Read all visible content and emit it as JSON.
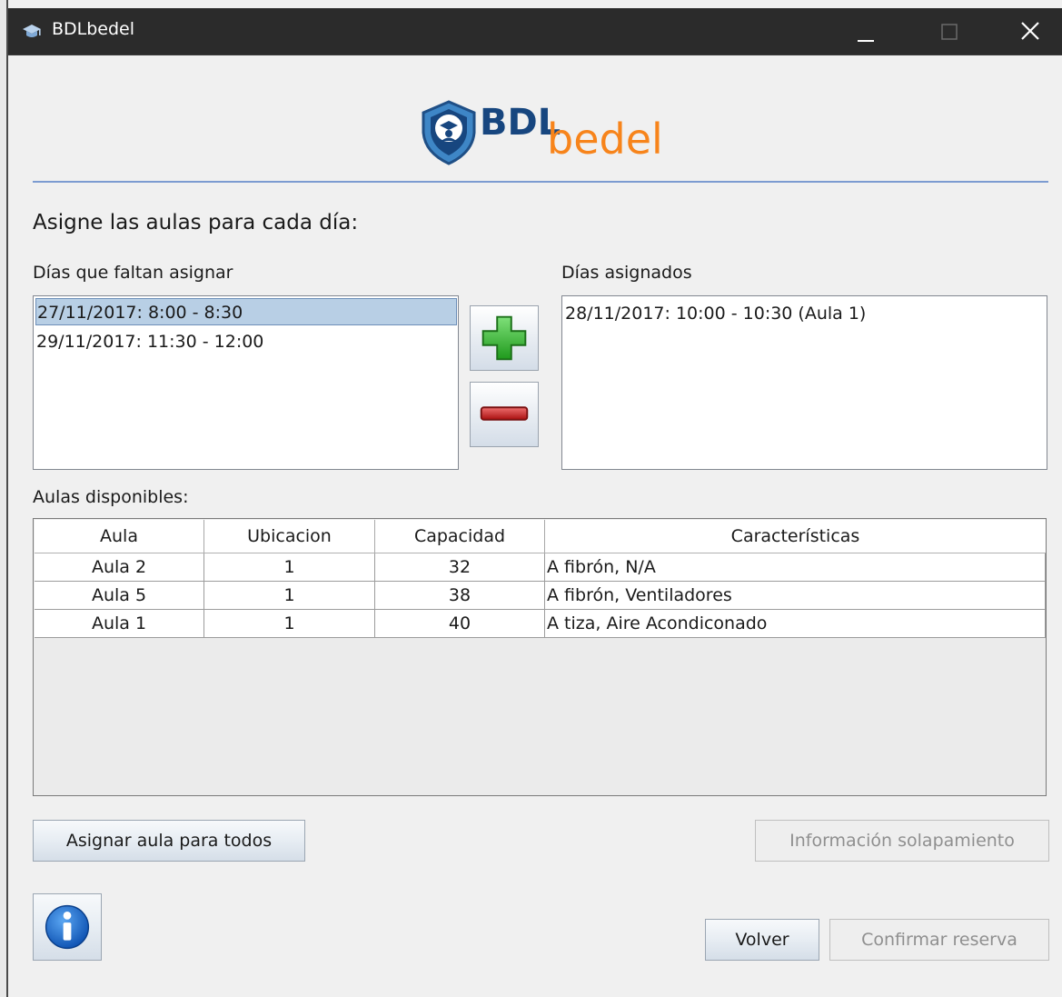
{
  "window": {
    "title": "BDLbedel",
    "controls": [
      "minimize",
      "maximize",
      "close"
    ]
  },
  "logo": {
    "part1": "BDL",
    "part2": "bedel",
    "colors": {
      "blue": "#17467f",
      "orange": "#f7841b"
    }
  },
  "heading": "Asigne las aulas para cada día:",
  "unassigned": {
    "label": "Días que faltan asignar",
    "items": [
      {
        "text": "27/11/2017: 8:00 - 8:30",
        "selected": true
      },
      {
        "text": "29/11/2017: 11:30 - 12:00",
        "selected": false
      }
    ]
  },
  "assigned": {
    "label": "Días asignados",
    "items": [
      {
        "text": "28/11/2017: 10:00 - 10:30 (Aula 1)"
      }
    ]
  },
  "transfer_buttons": {
    "add_icon": "green-plus-icon",
    "remove_icon": "red-minus-icon"
  },
  "classrooms": {
    "label": "Aulas disponibles:",
    "columns": [
      "Aula",
      "Ubicacion",
      "Capacidad",
      "Características"
    ],
    "rows": [
      [
        "Aula 2",
        "1",
        "32",
        "A fibrón, N/A"
      ],
      [
        "Aula 5",
        "1",
        "38",
        "A fibrón, Ventiladores"
      ],
      [
        "Aula 1",
        "1",
        "40",
        "A tiza, Aire Acondiconado"
      ]
    ]
  },
  "buttons": {
    "assign_all": "Asignar aula para todos",
    "overlap_info": "Información solapamiento",
    "back": "Volver",
    "confirm": "Confirmar reserva",
    "info_icon": "info-icon"
  }
}
